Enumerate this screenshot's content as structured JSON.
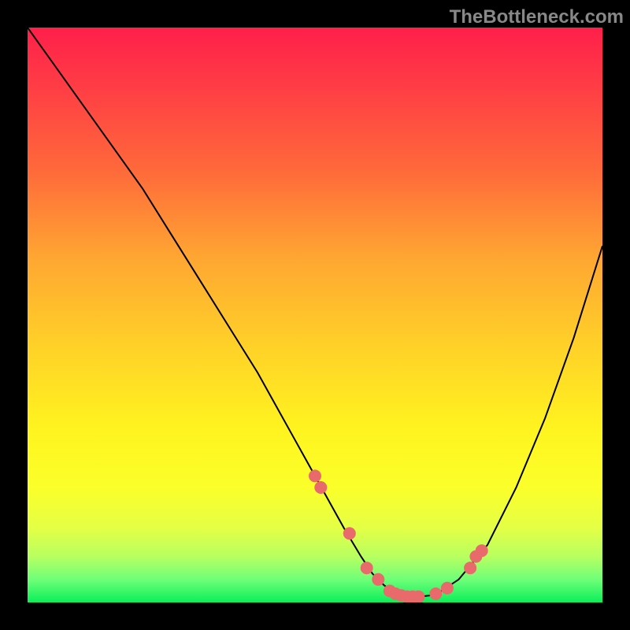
{
  "watermark": "TheBottleneck.com",
  "chart_data": {
    "type": "line",
    "title": "",
    "xlabel": "",
    "ylabel": "",
    "xlim": [
      0,
      100
    ],
    "ylim": [
      0,
      100
    ],
    "curve": {
      "x": [
        0,
        5,
        10,
        15,
        20,
        25,
        30,
        35,
        40,
        45,
        50,
        55,
        58,
        60,
        62,
        64,
        66,
        68,
        70,
        72,
        75,
        80,
        85,
        90,
        95,
        100
      ],
      "y": [
        100,
        93,
        86,
        79,
        72,
        64,
        56,
        48,
        40,
        31,
        22,
        13,
        8,
        5,
        3,
        1.5,
        1,
        1,
        1.2,
        2,
        4,
        10,
        20,
        32,
        46,
        62
      ]
    },
    "markers": {
      "x": [
        50,
        51,
        56,
        59,
        61,
        63,
        64,
        65,
        66,
        67,
        68,
        71,
        73,
        77,
        78,
        79
      ],
      "y": [
        22,
        20,
        12,
        6,
        4,
        2,
        1.5,
        1.2,
        1,
        1,
        1,
        1.5,
        2.5,
        6,
        8,
        9
      ],
      "color": "#e86a6a"
    },
    "gradient_stops": [
      {
        "pos": 0,
        "color": "#ff1f4a"
      },
      {
        "pos": 25,
        "color": "#ff6a3a"
      },
      {
        "pos": 55,
        "color": "#ffd028"
      },
      {
        "pos": 80,
        "color": "#fbff2a"
      },
      {
        "pos": 96,
        "color": "#6eff78"
      },
      {
        "pos": 100,
        "color": "#0bef59"
      }
    ]
  }
}
